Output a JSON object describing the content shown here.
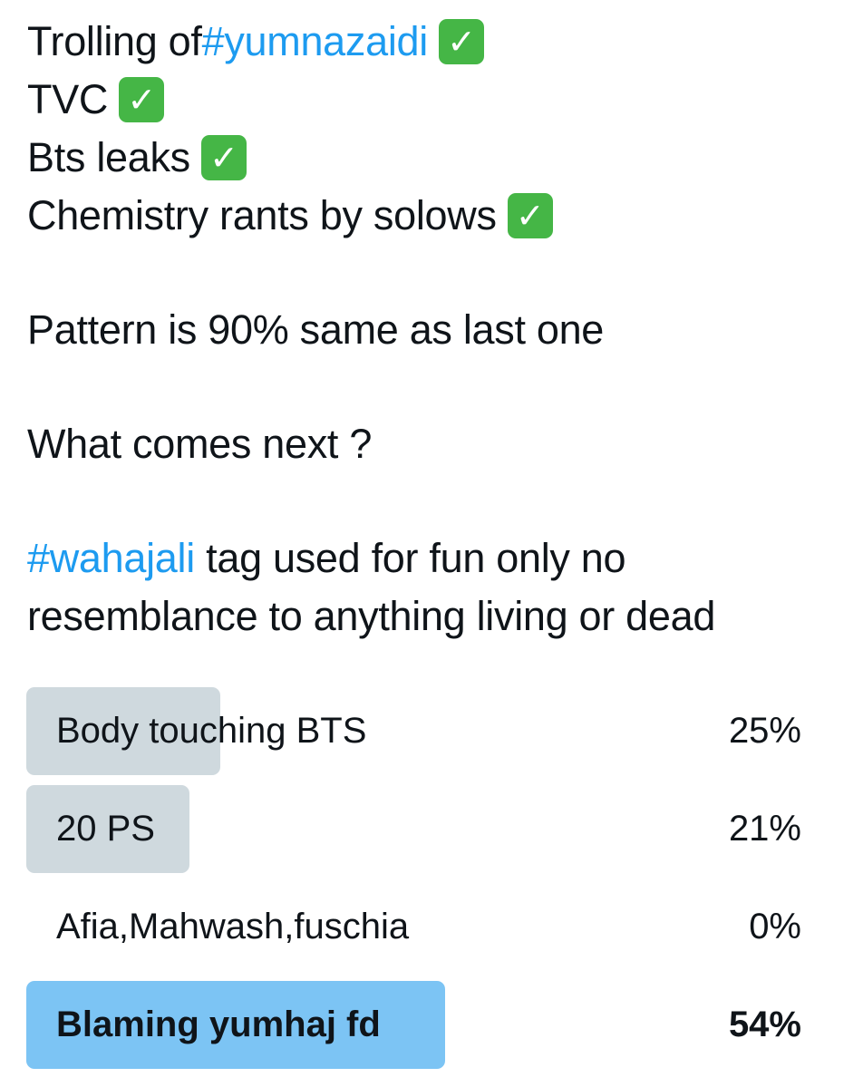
{
  "tweet": {
    "line1_text": "Trolling of ",
    "line1_hashtag": "#yumnazaidi",
    "line2_text": "TVC",
    "line3_text": "Bts leaks",
    "line4_text": "Chemistry rants by solows",
    "check_glyph": "✓",
    "check_color": "#45b646",
    "pattern_line": "Pattern is 90% same as last one",
    "question_line": "What comes next ?",
    "disclaimer_hashtag": "#wahajali",
    "disclaimer_line1": " tag used for fun only no",
    "disclaimer_line2": "resemblance to anything living or dead",
    "hashtag_color": "#1d9bf0"
  },
  "poll": {
    "options": [
      {
        "label": "Body touching BTS",
        "percent_text": "25%",
        "percent": 25
      },
      {
        "label": "20 PS",
        "percent_text": "21%",
        "percent": 21
      },
      {
        "label": "Afia,Mahwash,fuschia",
        "percent_text": "0%",
        "percent": 0
      },
      {
        "label": "Blaming yumhaj fd",
        "percent_text": "54%",
        "percent": 54,
        "winner": true
      }
    ],
    "bar_color": "#cfd9de",
    "winner_bar_color": "#7cc4f4"
  }
}
